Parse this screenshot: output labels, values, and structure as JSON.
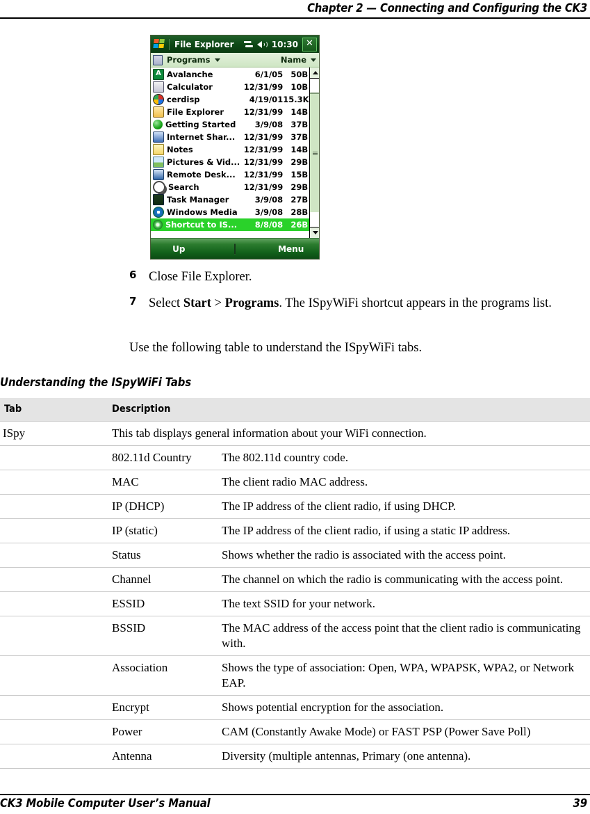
{
  "header": {
    "chapter_title": "Chapter 2 — Connecting and Configuring the CK3"
  },
  "footer": {
    "manual_title": "CK3 Mobile Computer User’s Manual",
    "page_number": "39"
  },
  "screenshot": {
    "titlebar": {
      "app_title": "File Explorer",
      "time": "10:30",
      "close_label": "✕"
    },
    "pathbar": {
      "folder": "Programs",
      "sort": "Name"
    },
    "files": [
      {
        "name": "Avalanche",
        "date": "6/1/05",
        "size": "50B",
        "icon": "avalanche-icon",
        "selected": false
      },
      {
        "name": "Calculator",
        "date": "12/31/99",
        "size": "10B",
        "icon": "calculator-icon",
        "selected": false
      },
      {
        "name": "cerdisp",
        "date": "4/19/01",
        "size": "15.3K",
        "icon": "cerdisp-icon",
        "selected": false
      },
      {
        "name": "File Explorer",
        "date": "12/31/99",
        "size": "14B",
        "icon": "file-explorer-icon",
        "selected": false
      },
      {
        "name": "Getting Started",
        "date": "3/9/08",
        "size": "37B",
        "icon": "getting-started-icon",
        "selected": false
      },
      {
        "name": "Internet Shar...",
        "date": "12/31/99",
        "size": "37B",
        "icon": "internet-sharing-icon",
        "selected": false
      },
      {
        "name": "Notes",
        "date": "12/31/99",
        "size": "14B",
        "icon": "notes-icon",
        "selected": false
      },
      {
        "name": "Pictures & Vid...",
        "date": "12/31/99",
        "size": "29B",
        "icon": "pictures-videos-icon",
        "selected": false
      },
      {
        "name": "Remote Desk...",
        "date": "12/31/99",
        "size": "15B",
        "icon": "remote-desktop-icon",
        "selected": false
      },
      {
        "name": "Search",
        "date": "12/31/99",
        "size": "29B",
        "icon": "search-icon",
        "selected": false
      },
      {
        "name": "Task Manager",
        "date": "3/9/08",
        "size": "27B",
        "icon": "task-manager-icon",
        "selected": false
      },
      {
        "name": "Windows Media",
        "date": "3/9/08",
        "size": "28B",
        "icon": "windows-media-icon",
        "selected": false
      },
      {
        "name": "Shortcut to IS...",
        "date": "8/8/08",
        "size": "26B",
        "icon": "shortcut-ispywifi-icon",
        "selected": true
      }
    ],
    "softkeys": {
      "left": "Up",
      "right": "Menu"
    },
    "colors": {
      "titlebar": "#0d4715",
      "selection": "#2ad22a",
      "pathbar": "#cfe6c4",
      "softbar": "#11601a"
    }
  },
  "steps": [
    {
      "number": "6",
      "text_before": "Close File Explorer.",
      "bold1": "",
      "text_mid": "",
      "bold2": "",
      "text_after": ""
    },
    {
      "number": "7",
      "text_before": "Select ",
      "bold1": "Start",
      "text_mid": " > ",
      "bold2": "Programs",
      "text_after": ". The ISpyWiFi shortcut appears in the programs list."
    }
  ],
  "lead_in": "Use the following table to understand the ISpyWiFi tabs.",
  "table": {
    "caption": "Understanding the ISpyWiFi Tabs",
    "headers": {
      "col1": "Tab",
      "col2": "Description"
    },
    "rows": [
      {
        "tab": "ISpy",
        "field": "",
        "description": "This tab displays general information about your WiFi connection."
      },
      {
        "tab": "",
        "field": "802.11d Country",
        "description": "The 802.11d country code."
      },
      {
        "tab": "",
        "field": "MAC",
        "description": "The client radio MAC address."
      },
      {
        "tab": "",
        "field": "IP (DHCP)",
        "description": "The IP address of the client radio, if using DHCP."
      },
      {
        "tab": "",
        "field": "IP (static)",
        "description": "The IP address of the client radio, if using a static IP address."
      },
      {
        "tab": "",
        "field": "Status",
        "description": "Shows whether the radio is associated with the access point."
      },
      {
        "tab": "",
        "field": "Channel",
        "description": "The channel on which the radio is communicating with the access point."
      },
      {
        "tab": "",
        "field": "ESSID",
        "description": "The text SSID for your network."
      },
      {
        "tab": "",
        "field": "BSSID",
        "description": "The MAC address of the access point that the client radio is communicating with."
      },
      {
        "tab": "",
        "field": "Association",
        "description": "Shows the type of association: Open, WPA, WPAPSK, WPA2, or Network EAP."
      },
      {
        "tab": "",
        "field": "Encrypt",
        "description": "Shows potential encryption for the association."
      },
      {
        "tab": "",
        "field": "Power",
        "description": "CAM (Constantly Awake Mode) or FAST PSP (Power Save Poll)"
      },
      {
        "tab": "",
        "field": "Antenna",
        "description": "Diversity (multiple antennas, Primary (one antenna)."
      }
    ]
  }
}
